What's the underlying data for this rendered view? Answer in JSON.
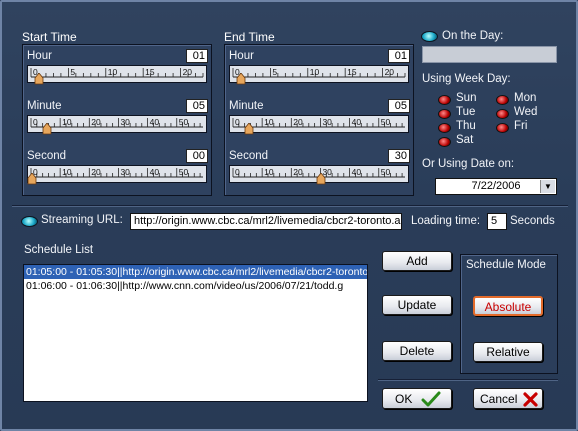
{
  "start_time": {
    "title": "Start Time",
    "hour": {
      "label": "Hour",
      "value": "01",
      "ticks": [
        "0",
        "5",
        "10",
        "15",
        "20"
      ]
    },
    "minute": {
      "label": "Minute",
      "value": "05",
      "ticks": [
        "0",
        "10",
        "20",
        "30",
        "40",
        "50"
      ]
    },
    "second": {
      "label": "Second",
      "value": "00",
      "ticks": [
        "0",
        "10",
        "20",
        "30",
        "40",
        "50"
      ]
    }
  },
  "end_time": {
    "title": "End Time",
    "hour": {
      "label": "Hour",
      "value": "01",
      "ticks": [
        "0",
        "5",
        "10",
        "15",
        "20"
      ]
    },
    "minute": {
      "label": "Minute",
      "value": "05",
      "ticks": [
        "0",
        "10",
        "20",
        "30",
        "40",
        "50"
      ]
    },
    "second": {
      "label": "Second",
      "value": "30",
      "ticks": [
        "0",
        "10",
        "20",
        "30",
        "40",
        "50"
      ]
    }
  },
  "on_the_day": {
    "label": "On the Day:",
    "value": ""
  },
  "week_day": {
    "label": "Using Week Day:",
    "days": [
      "Sun",
      "Mon",
      "Tue",
      "Wed",
      "Thu",
      "Fri",
      "Sat"
    ]
  },
  "date": {
    "label": "Or Using Date on:",
    "value": "7/22/2006"
  },
  "streaming": {
    "label": "Streaming URL:",
    "value": "http://origin.www.cbc.ca/mrl2/livemedia/cbcr2-toronto.a"
  },
  "loading": {
    "label": "Loading time:",
    "value": "5",
    "unit": "Seconds"
  },
  "schedule": {
    "title": "Schedule List",
    "rows": [
      "01:05:00 - 01:05:30||http://origin.www.cbc.ca/mrl2/livemedia/cbcr2-toronto",
      "01:06:00 - 01:06:30||http://www.cnn.com/video/us/2006/07/21/todd.g"
    ]
  },
  "buttons": {
    "add": "Add",
    "update": "Update",
    "delete": "Delete",
    "ok": "OK",
    "cancel": "Cancel"
  },
  "mode": {
    "title": "Schedule Mode",
    "absolute": "Absolute",
    "relative": "Relative"
  },
  "colors": {
    "accent_red": "#c80000",
    "selection": "#2e62b5",
    "ok_check": "#2a8a1a",
    "cancel_x": "#c80000"
  }
}
